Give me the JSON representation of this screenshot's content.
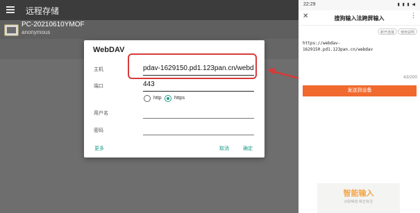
{
  "left_app": {
    "title": "远程存储",
    "server": {
      "name": "PC-20210610YMOF",
      "user": "anonymous"
    }
  },
  "dialog": {
    "title": "WebDAV",
    "host_label": "主机",
    "host_value": "pdav-1629150.pd1.123pan.cn/webdav",
    "port_label": "端口",
    "port_value": "443",
    "protocol_options": [
      "http",
      "https"
    ],
    "protocol_selected": "https",
    "username_label": "用户名",
    "username_value": "",
    "password_label": "密码",
    "password_value": "",
    "more_label": "更多",
    "cancel_label": "取消",
    "ok_label": "确定"
  },
  "phone": {
    "time": "22:29",
    "status_icons": "▮ ▮ ▮ ◀",
    "title": "搜狗输入法跨屏输入",
    "chips": [
      "断开连接",
      "使用说明"
    ],
    "url_text": "https://webdav-\n1629150.pd1.123pan.cn/webdav",
    "char_count": "43/200",
    "send_label": "发送到设备",
    "ad_title": "智能输入",
    "ad_subtitle": "识别噪音 和正标注"
  },
  "colors": {
    "accent": "#1a9e86",
    "highlight": "#d73a3a",
    "send": "#f06a2e"
  }
}
